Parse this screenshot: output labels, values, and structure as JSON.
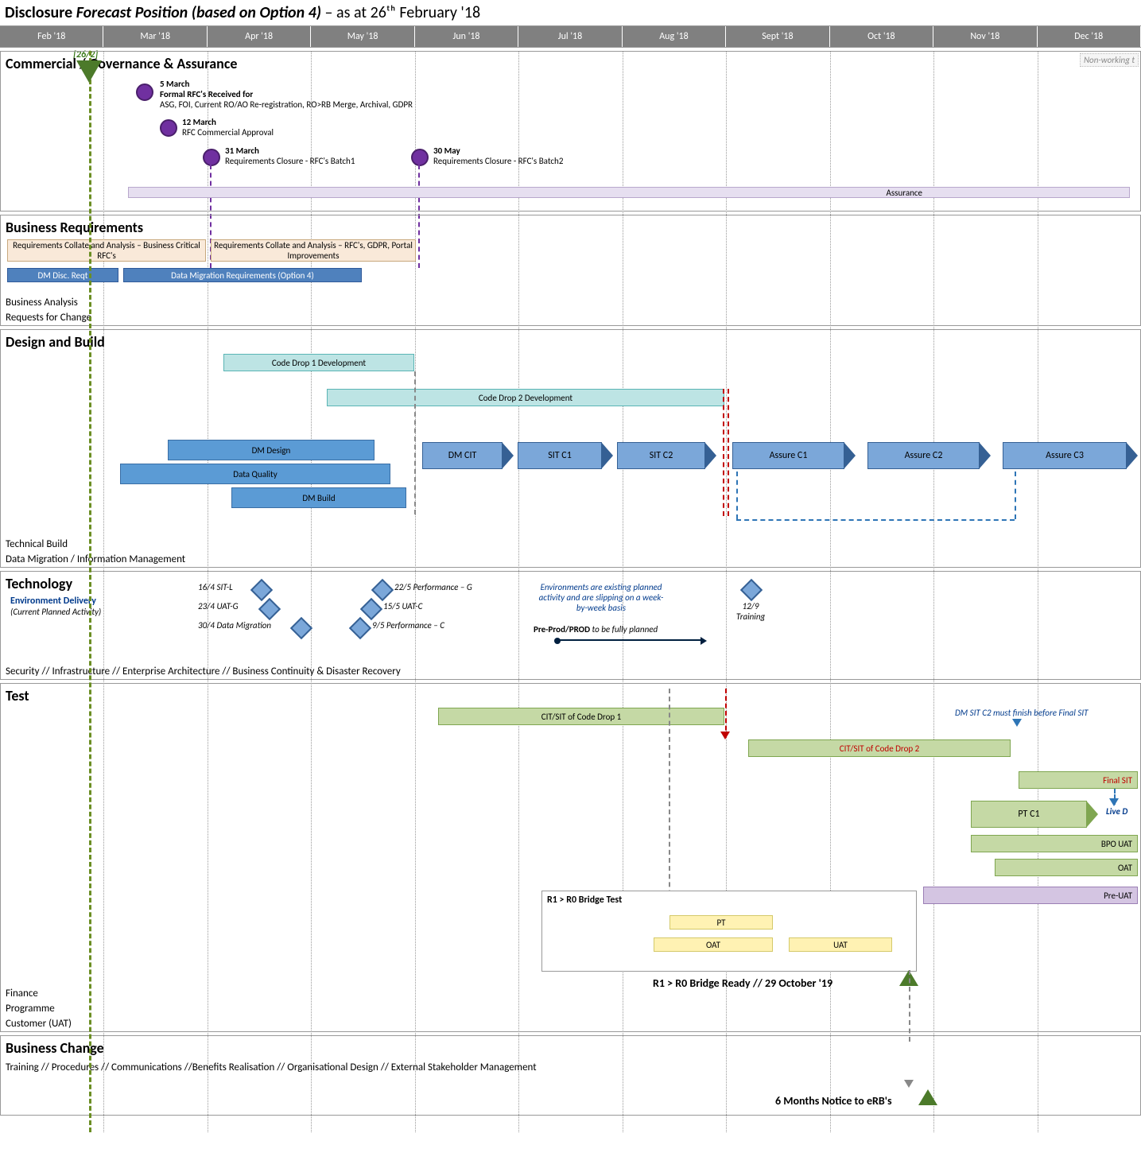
{
  "title_prefix": "Disclosure",
  "title_italic": "Forecast Position (based on Option 4)",
  "title_suffix": "– as at 26ᵗʰ February '18",
  "today_label": "[26/2]",
  "nonworking": "Non-working t",
  "months": [
    "Feb '18",
    "Mar '18",
    "Apr '18",
    "May '18",
    "Jun '18",
    "Jul '18",
    "Aug '18",
    "Sept '18",
    "Oct '18",
    "Nov '18",
    "Dec '18"
  ],
  "swim": {
    "commercial": {
      "heading": "Commercial / Governance & Assurance",
      "m1_date": "5 March",
      "m1_t": "Formal RFC's Received for",
      "m1_d": "ASG, FOI, Current RO/AO Re-registration, RO>RB Merge, Archival, GDPR",
      "m2_date": "12 March",
      "m2_t": "RFC Commercial Approval",
      "m3_date": "31 March",
      "m3_t": "Requirements Closure - RFC's Batch1",
      "m4_date": "30 May",
      "m4_t": "Requirements Closure - RFC's Batch2",
      "assurance": "Assurance"
    },
    "bizreq": {
      "heading": "Business Requirements",
      "bar1": "Requirements Collate and Analysis – Business Critical RFC's",
      "bar2": "Requirements Collate and Analysis – RFC's, GDPR, Portal Improvements",
      "bar3": "DM Disc. Reqt",
      "bar4": "Data Migration Requirements (Option 4)",
      "f1": "Business Analysis",
      "f2": "Requests for Change"
    },
    "design": {
      "heading": "Design and Build",
      "cd1": "Code Drop 1 Development",
      "cd2": "Code Drop 2 Development",
      "dm_design": "DM Design",
      "dq": "Data Quality",
      "dm_build": "DM Build",
      "dm_cit": "DM CIT",
      "sit_c1": "SIT C1",
      "sit_c2": "SIT C2",
      "a_c1": "Assure C1",
      "a_c2": "Assure C2",
      "a_c3": "Assure C3",
      "f1": "Technical Build",
      "f2": "Data Migration / Information Management"
    },
    "tech": {
      "heading": "Technology",
      "sub": "Environment Delivery",
      "sub2": "(Current Planned Activity)",
      "d1": "16/4 SIT-L",
      "d2": "23/4 UAT-G",
      "d3": "30/4 Data Migration",
      "d4": "22/5 Performance – G",
      "d5": "15/5 UAT-C",
      "d6": "9/5  Performance – C",
      "note1a": "Environments are existing planned",
      "note1b": "activity and are slipping on a week-",
      "note1c": "by-week basis",
      "note2a": "Pre-Prod/PROD",
      "note2b": " to be fully planned",
      "d7a": "12/9",
      "d7b": "Training",
      "f1": "Security // Infrastructure // Enterprise Architecture // Business Continuity & Disaster Recovery"
    },
    "test": {
      "heading": "Test",
      "t1": "CIT/SIT of Code Drop 1",
      "t2": "CIT/SIT of Code Drop 2",
      "t3": "Final SIT",
      "pt_c1": "PT C1",
      "live_d": "Live D",
      "bpo": "BPO UAT",
      "oat": "OAT",
      "preuat": "Pre-UAT",
      "note": "DM SIT C2 must finish before Final SIT",
      "box_h": "R1 > R0 Bridge Test",
      "box_pt": "PT",
      "box_oat": "OAT",
      "box_uat": "UAT",
      "ready": "R1 > R0 Bridge Ready // 29 October '19",
      "f1": "Finance",
      "f2": "Programme",
      "f3": "Customer (UAT)"
    },
    "change": {
      "heading": "Business Change",
      "f1": "Training // Procedures // Communications //Benefits Realisation // Organisational Design // External Stakeholder Management",
      "erb": "6 Months Notice to eRB's"
    }
  }
}
